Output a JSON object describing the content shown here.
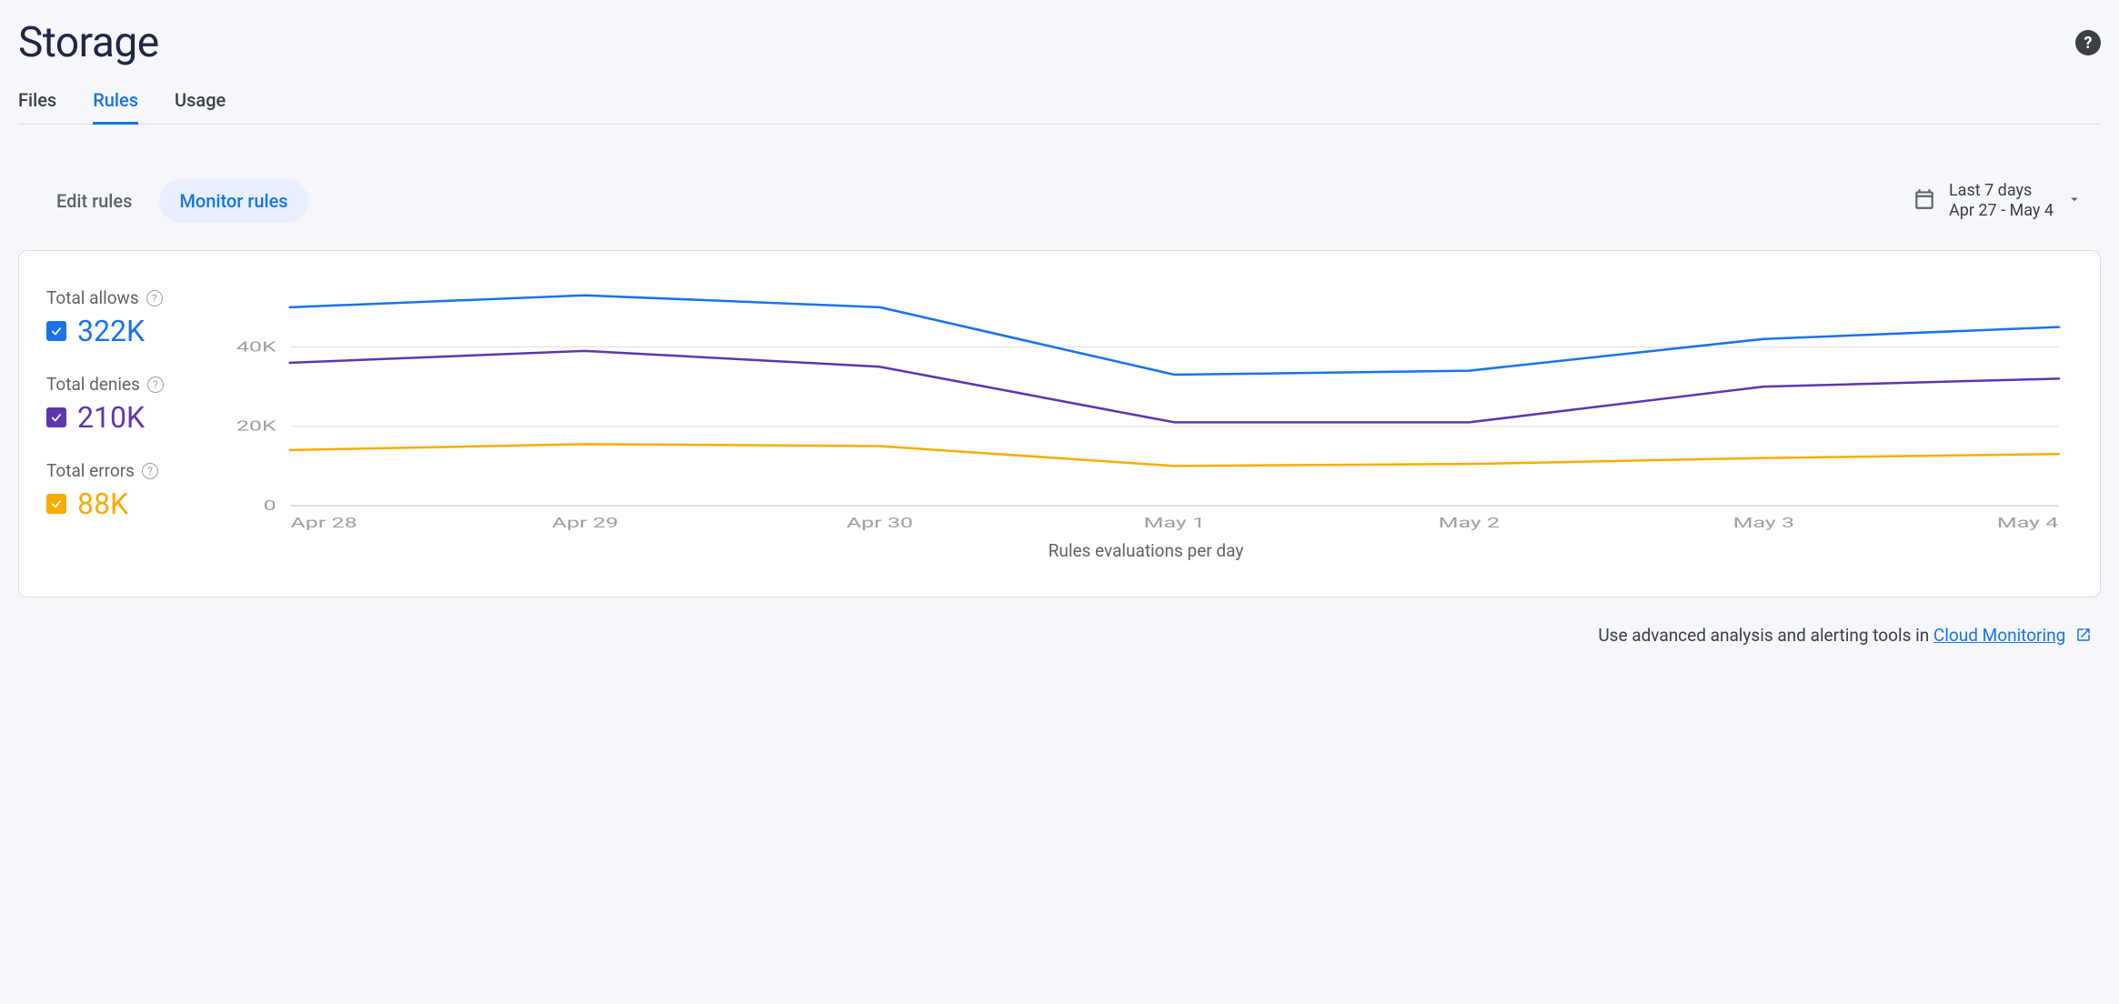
{
  "page": {
    "title": "Storage"
  },
  "tabs": [
    {
      "label": "Files",
      "active": false
    },
    {
      "label": "Rules",
      "active": true
    },
    {
      "label": "Usage",
      "active": false
    }
  ],
  "subtabs": [
    {
      "label": "Edit rules",
      "active": false
    },
    {
      "label": "Monitor rules",
      "active": true
    }
  ],
  "date_range": {
    "line1": "Last 7 days",
    "line2": "Apr 27 - May 4"
  },
  "metrics": [
    {
      "label": "Total allows",
      "value": "322K",
      "color": "#1a73e8"
    },
    {
      "label": "Total denies",
      "value": "210K",
      "color": "#5e35b1"
    },
    {
      "label": "Total errors",
      "value": "88K",
      "color": "#f9ab00"
    }
  ],
  "footer": {
    "prefix": "Use advanced analysis and alerting tools in ",
    "link_text": "Cloud Monitoring"
  },
  "chart_data": {
    "type": "line",
    "title": "",
    "xlabel": "Rules evaluations per day",
    "ylabel": "",
    "ylim": [
      0,
      55000
    ],
    "y_ticks": [
      0,
      20000,
      40000
    ],
    "y_tick_labels": [
      "0",
      "20K",
      "40K"
    ],
    "categories": [
      "Apr 28",
      "Apr 29",
      "Apr 30",
      "May 1",
      "May 2",
      "May 3",
      "May 4"
    ],
    "series": [
      {
        "name": "Total allows",
        "color": "#1a73e8",
        "values": [
          50000,
          53000,
          50000,
          33000,
          34000,
          42000,
          45000
        ]
      },
      {
        "name": "Total denies",
        "color": "#5e35b1",
        "values": [
          36000,
          39000,
          35000,
          21000,
          21000,
          30000,
          32000
        ]
      },
      {
        "name": "Total errors",
        "color": "#f9ab00",
        "values": [
          14000,
          15500,
          15000,
          10000,
          10500,
          12000,
          13000
        ]
      }
    ]
  }
}
